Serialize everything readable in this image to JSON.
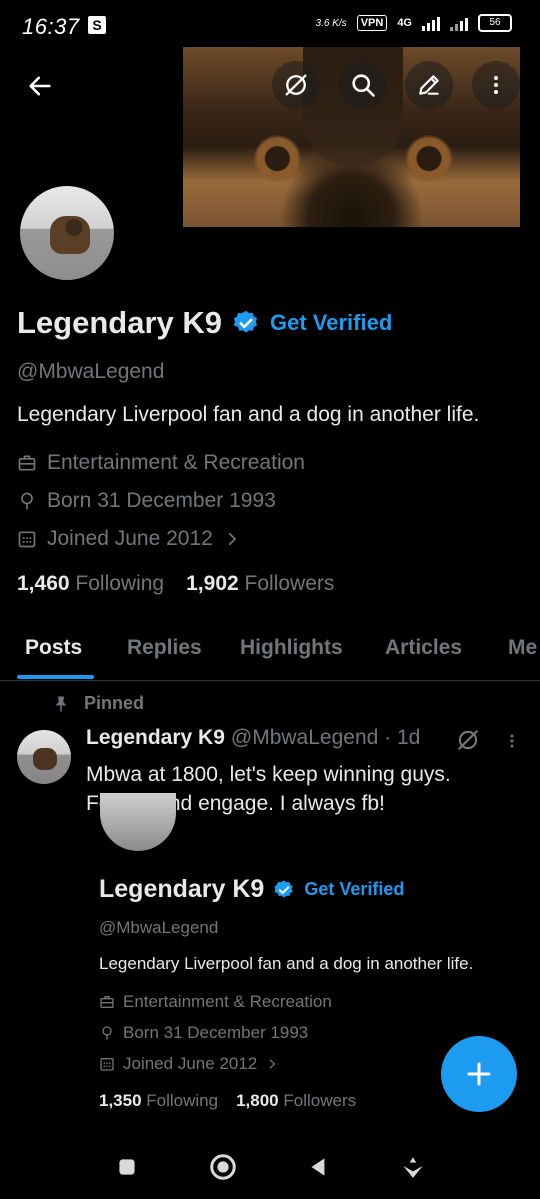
{
  "status_bar": {
    "time": "16:37",
    "badge": "S",
    "network_speed": "3.6 K/s",
    "vpn": "VPN",
    "network_type": "4G",
    "battery": "56"
  },
  "profile": {
    "display_name": "Legendary K9",
    "get_verified": "Get Verified",
    "handle": "@MbwaLegend",
    "bio": "Legendary Liverpool fan and a dog in another life.",
    "category": "Entertainment & Recreation",
    "born": "Born 31 December 1993",
    "joined": "Joined June 2012",
    "following_count": "1,460",
    "following_label": "Following",
    "followers_count": "1,902",
    "followers_label": "Followers"
  },
  "tabs": [
    {
      "label": "Posts"
    },
    {
      "label": "Replies"
    },
    {
      "label": "Highlights"
    },
    {
      "label": "Articles"
    },
    {
      "label": "Me"
    }
  ],
  "pinned_post": {
    "pinned_label": "Pinned",
    "author": "Legendary K9",
    "handle_time": "@MbwaLegend · 1d",
    "text": "Mbwa at 1800, let's keep winning guys. Follow, and engage. I always fb!",
    "embedded": {
      "display_name": "Legendary K9",
      "get_verified": "Get Verified",
      "handle": "@MbwaLegend",
      "bio": "Legendary Liverpool fan and a dog in another life.",
      "category": "Entertainment & Recreation",
      "born": "Born 31 December 1993",
      "joined": "Joined June 2012",
      "following_count": "1,350",
      "following_label": "Following",
      "followers_count": "1,800",
      "followers_label": "Followers"
    }
  },
  "colors": {
    "accent": "#1d9bf0",
    "background": "#000000",
    "text_primary": "#e7e9ea",
    "text_secondary": "#71767b"
  },
  "icons": {
    "back": "arrow-left-icon",
    "grok": "grok-icon",
    "search": "search-icon",
    "edit": "edit-icon",
    "more": "more-vertical-icon",
    "verified": "verified-badge-icon",
    "category": "briefcase-icon",
    "born": "location-pin-icon",
    "joined": "calendar-icon",
    "pin": "pin-icon",
    "fab": "plus-icon"
  }
}
